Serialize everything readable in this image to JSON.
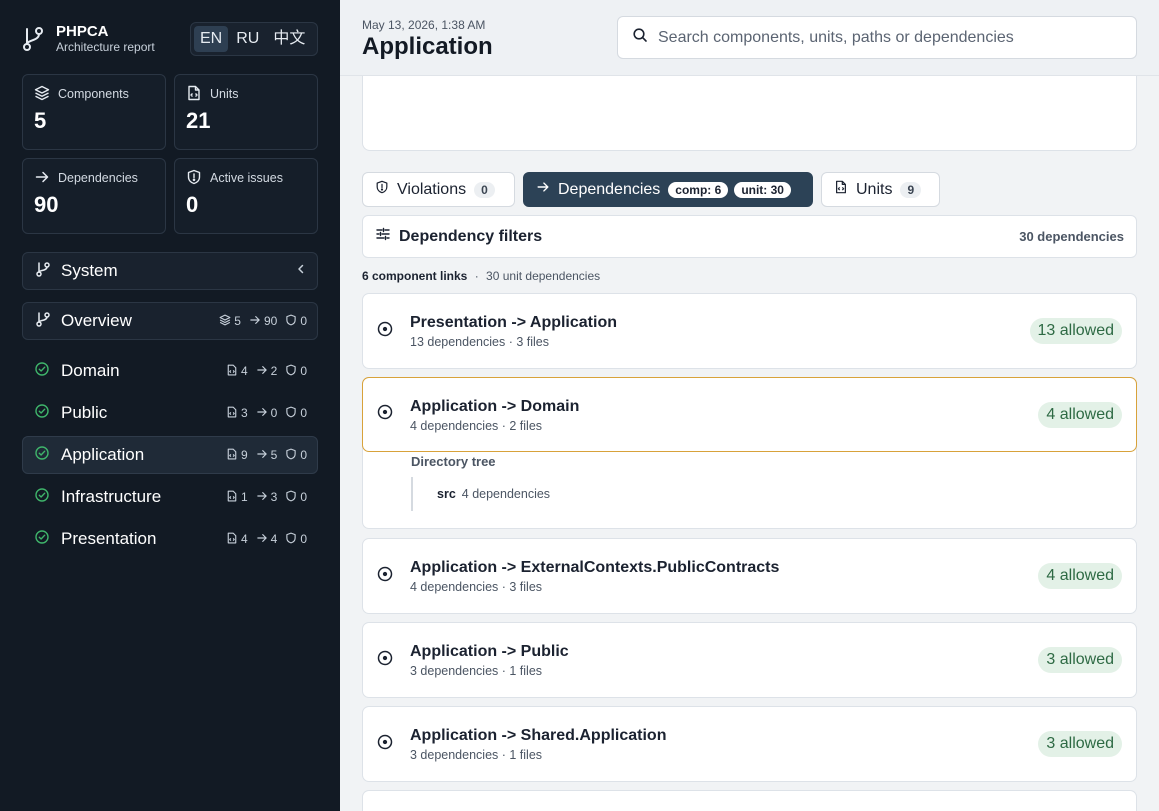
{
  "brand": {
    "name": "PHPCA",
    "subtitle": "Architecture report"
  },
  "languages": [
    "EN",
    "RU",
    "中文"
  ],
  "stats": {
    "components": {
      "label": "Components",
      "value": "5"
    },
    "units": {
      "label": "Units",
      "value": "21"
    },
    "dependencies": {
      "label": "Dependencies",
      "value": "90"
    },
    "issues": {
      "label": "Active issues",
      "value": "0"
    }
  },
  "system": {
    "label": "System"
  },
  "overview": {
    "label": "Overview",
    "components": "5",
    "dependencies": "90",
    "issues": "0"
  },
  "components": [
    {
      "name": "Domain",
      "units": "4",
      "deps": "2",
      "issues": "0"
    },
    {
      "name": "Public",
      "units": "3",
      "deps": "0",
      "issues": "0"
    },
    {
      "name": "Application",
      "units": "9",
      "deps": "5",
      "issues": "0"
    },
    {
      "name": "Infrastructure",
      "units": "1",
      "deps": "3",
      "issues": "0"
    },
    {
      "name": "Presentation",
      "units": "4",
      "deps": "4",
      "issues": "0"
    }
  ],
  "header": {
    "date": "May 13, 2026, 1:38 AM",
    "title": "Application",
    "search_placeholder": "Search components, units, paths or dependencies"
  },
  "tabs": {
    "violations": {
      "label": "Violations",
      "count": "0"
    },
    "dependencies": {
      "label": "Dependencies",
      "comp": "comp: 6",
      "unit": "unit: 30"
    },
    "units": {
      "label": "Units",
      "count": "9"
    }
  },
  "filters": {
    "title": "Dependency filters",
    "count": "30 dependencies"
  },
  "summary": {
    "links": "6 component links",
    "sep": "·",
    "units": "30 unit dependencies"
  },
  "deps": [
    {
      "name": "Presentation -> Application",
      "sub": "13 dependencies · 3 files",
      "allowed": "13 allowed"
    },
    {
      "name": "Application -> Domain",
      "sub": "4 dependencies · 2 files",
      "allowed": "4 allowed"
    },
    {
      "name": "Application -> ExternalContexts.PublicContracts",
      "sub": "4 dependencies · 3 files",
      "allowed": "4 allowed"
    },
    {
      "name": "Application -> Public",
      "sub": "3 dependencies · 1 files",
      "allowed": "3 allowed"
    },
    {
      "name": "Application -> Shared.Application",
      "sub": "3 dependencies · 1 files",
      "allowed": "3 allowed"
    }
  ],
  "tree": {
    "title": "Directory tree",
    "dir": "src",
    "count": "4 dependencies"
  },
  "colors": {
    "sidebar": "#121a24",
    "accent": "#2c4256",
    "allowed_bg": "#e3f1e7",
    "allowed_text": "#2e6a44",
    "highlight": "#d8a23a",
    "check": "#3fb56b"
  }
}
